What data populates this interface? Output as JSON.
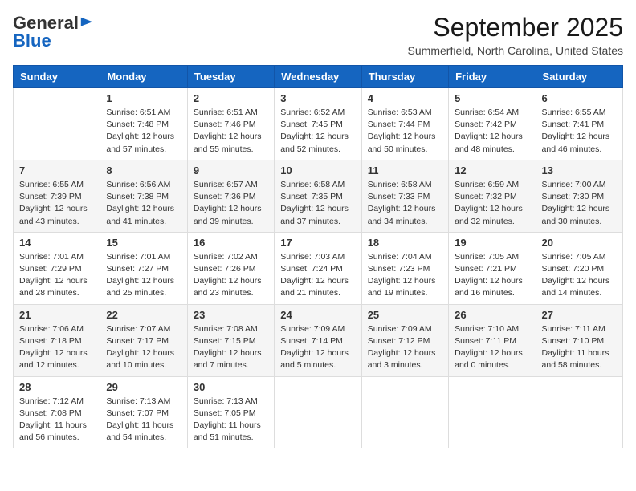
{
  "logo": {
    "general": "General",
    "blue": "Blue"
  },
  "title": "September 2025",
  "subtitle": "Summerfield, North Carolina, United States",
  "headers": [
    "Sunday",
    "Monday",
    "Tuesday",
    "Wednesday",
    "Thursday",
    "Friday",
    "Saturday"
  ],
  "weeks": [
    [
      {
        "num": "",
        "info": ""
      },
      {
        "num": "1",
        "info": "Sunrise: 6:51 AM\nSunset: 7:48 PM\nDaylight: 12 hours\nand 57 minutes."
      },
      {
        "num": "2",
        "info": "Sunrise: 6:51 AM\nSunset: 7:46 PM\nDaylight: 12 hours\nand 55 minutes."
      },
      {
        "num": "3",
        "info": "Sunrise: 6:52 AM\nSunset: 7:45 PM\nDaylight: 12 hours\nand 52 minutes."
      },
      {
        "num": "4",
        "info": "Sunrise: 6:53 AM\nSunset: 7:44 PM\nDaylight: 12 hours\nand 50 minutes."
      },
      {
        "num": "5",
        "info": "Sunrise: 6:54 AM\nSunset: 7:42 PM\nDaylight: 12 hours\nand 48 minutes."
      },
      {
        "num": "6",
        "info": "Sunrise: 6:55 AM\nSunset: 7:41 PM\nDaylight: 12 hours\nand 46 minutes."
      }
    ],
    [
      {
        "num": "7",
        "info": "Sunrise: 6:55 AM\nSunset: 7:39 PM\nDaylight: 12 hours\nand 43 minutes."
      },
      {
        "num": "8",
        "info": "Sunrise: 6:56 AM\nSunset: 7:38 PM\nDaylight: 12 hours\nand 41 minutes."
      },
      {
        "num": "9",
        "info": "Sunrise: 6:57 AM\nSunset: 7:36 PM\nDaylight: 12 hours\nand 39 minutes."
      },
      {
        "num": "10",
        "info": "Sunrise: 6:58 AM\nSunset: 7:35 PM\nDaylight: 12 hours\nand 37 minutes."
      },
      {
        "num": "11",
        "info": "Sunrise: 6:58 AM\nSunset: 7:33 PM\nDaylight: 12 hours\nand 34 minutes."
      },
      {
        "num": "12",
        "info": "Sunrise: 6:59 AM\nSunset: 7:32 PM\nDaylight: 12 hours\nand 32 minutes."
      },
      {
        "num": "13",
        "info": "Sunrise: 7:00 AM\nSunset: 7:30 PM\nDaylight: 12 hours\nand 30 minutes."
      }
    ],
    [
      {
        "num": "14",
        "info": "Sunrise: 7:01 AM\nSunset: 7:29 PM\nDaylight: 12 hours\nand 28 minutes."
      },
      {
        "num": "15",
        "info": "Sunrise: 7:01 AM\nSunset: 7:27 PM\nDaylight: 12 hours\nand 25 minutes."
      },
      {
        "num": "16",
        "info": "Sunrise: 7:02 AM\nSunset: 7:26 PM\nDaylight: 12 hours\nand 23 minutes."
      },
      {
        "num": "17",
        "info": "Sunrise: 7:03 AM\nSunset: 7:24 PM\nDaylight: 12 hours\nand 21 minutes."
      },
      {
        "num": "18",
        "info": "Sunrise: 7:04 AM\nSunset: 7:23 PM\nDaylight: 12 hours\nand 19 minutes."
      },
      {
        "num": "19",
        "info": "Sunrise: 7:05 AM\nSunset: 7:21 PM\nDaylight: 12 hours\nand 16 minutes."
      },
      {
        "num": "20",
        "info": "Sunrise: 7:05 AM\nSunset: 7:20 PM\nDaylight: 12 hours\nand 14 minutes."
      }
    ],
    [
      {
        "num": "21",
        "info": "Sunrise: 7:06 AM\nSunset: 7:18 PM\nDaylight: 12 hours\nand 12 minutes."
      },
      {
        "num": "22",
        "info": "Sunrise: 7:07 AM\nSunset: 7:17 PM\nDaylight: 12 hours\nand 10 minutes."
      },
      {
        "num": "23",
        "info": "Sunrise: 7:08 AM\nSunset: 7:15 PM\nDaylight: 12 hours\nand 7 minutes."
      },
      {
        "num": "24",
        "info": "Sunrise: 7:09 AM\nSunset: 7:14 PM\nDaylight: 12 hours\nand 5 minutes."
      },
      {
        "num": "25",
        "info": "Sunrise: 7:09 AM\nSunset: 7:12 PM\nDaylight: 12 hours\nand 3 minutes."
      },
      {
        "num": "26",
        "info": "Sunrise: 7:10 AM\nSunset: 7:11 PM\nDaylight: 12 hours\nand 0 minutes."
      },
      {
        "num": "27",
        "info": "Sunrise: 7:11 AM\nSunset: 7:10 PM\nDaylight: 11 hours\nand 58 minutes."
      }
    ],
    [
      {
        "num": "28",
        "info": "Sunrise: 7:12 AM\nSunset: 7:08 PM\nDaylight: 11 hours\nand 56 minutes."
      },
      {
        "num": "29",
        "info": "Sunrise: 7:13 AM\nSunset: 7:07 PM\nDaylight: 11 hours\nand 54 minutes."
      },
      {
        "num": "30",
        "info": "Sunrise: 7:13 AM\nSunset: 7:05 PM\nDaylight: 11 hours\nand 51 minutes."
      },
      {
        "num": "",
        "info": ""
      },
      {
        "num": "",
        "info": ""
      },
      {
        "num": "",
        "info": ""
      },
      {
        "num": "",
        "info": ""
      }
    ]
  ]
}
